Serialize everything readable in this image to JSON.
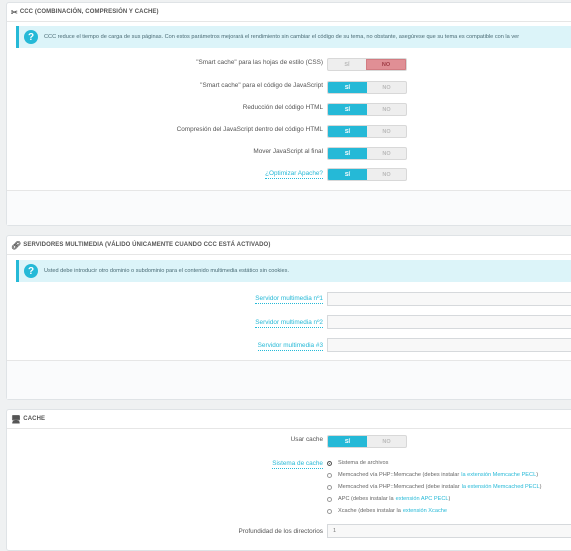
{
  "ccc": {
    "title": "CCC (COMBINACIÓN, COMPRESIÓN Y CACHE)",
    "info": "CCC reduce el tiempo de carga de sus páginas. Con estos parámetros mejorará el rendimiento sin cambiar el código de su tema, no obstante, asegúrese que su tema es compatible con la ver",
    "rows": [
      {
        "label": "\"Smart cache\" para las hojas de estilo (CSS)",
        "yes": "SÍ",
        "no": "NO",
        "value": "no"
      },
      {
        "label": "\"Smart cache\" para el código de JavaScript",
        "yes": "SÍ",
        "no": "NO",
        "value": "yes"
      },
      {
        "label": "Reducción del código HTML",
        "yes": "SÍ",
        "no": "NO",
        "value": "yes"
      },
      {
        "label": "Compresión del JavaScript dentro del código HTML",
        "yes": "SÍ",
        "no": "NO",
        "value": "yes"
      },
      {
        "label": "Mover JavaScript al final",
        "yes": "SÍ",
        "no": "NO",
        "value": "yes"
      },
      {
        "label": "¿Optimizar Apache?",
        "yes": "SÍ",
        "no": "NO",
        "value": "yes"
      }
    ]
  },
  "media": {
    "title": "SERVIDORES MULTIMEDIA (VÁLIDO ÚNICAMENTE CUANDO CCC ESTÁ ACTIVADO)",
    "info": "Usted debe introducir otro dominio o subdominio para el contenido multimedia estático sin cookies.",
    "servers": [
      {
        "label": "Servidor multimedia nº1",
        "value": ""
      },
      {
        "label": "Servidor multimedia nº2",
        "value": ""
      },
      {
        "label": "Servidor multimedia #3",
        "value": ""
      }
    ]
  },
  "cache": {
    "title": "CACHE",
    "use_cache_label": "Usar cache",
    "use_cache_yes": "SÍ",
    "use_cache_no": "NO",
    "use_cache_value": "yes",
    "system_label": "Sistema de cache",
    "options": [
      {
        "text": "Sistema de archivos",
        "link": "",
        "suffix": "",
        "checked": true
      },
      {
        "text": "Memcached vía PHP::Memcache (debes instalar ",
        "link": "la extensión Memcache PECL",
        "suffix": ")",
        "checked": false
      },
      {
        "text": "Memcached vía PHP::Memcached (debe instalar ",
        "link": "la extensión Memcached PECL",
        "suffix": ")",
        "checked": false
      },
      {
        "text": "APC (debes instalar la ",
        "link": "extensión APC PECL",
        "suffix": ")",
        "checked": false
      },
      {
        "text": "Xcache (debes instalar la ",
        "link": "extensión Xcache",
        "suffix": "",
        "checked": false
      }
    ],
    "depth_label": "Profundidad de los directorios",
    "depth_value": "1"
  },
  "colors": {
    "accent": "#25b9d7",
    "off": "#e08f95"
  }
}
